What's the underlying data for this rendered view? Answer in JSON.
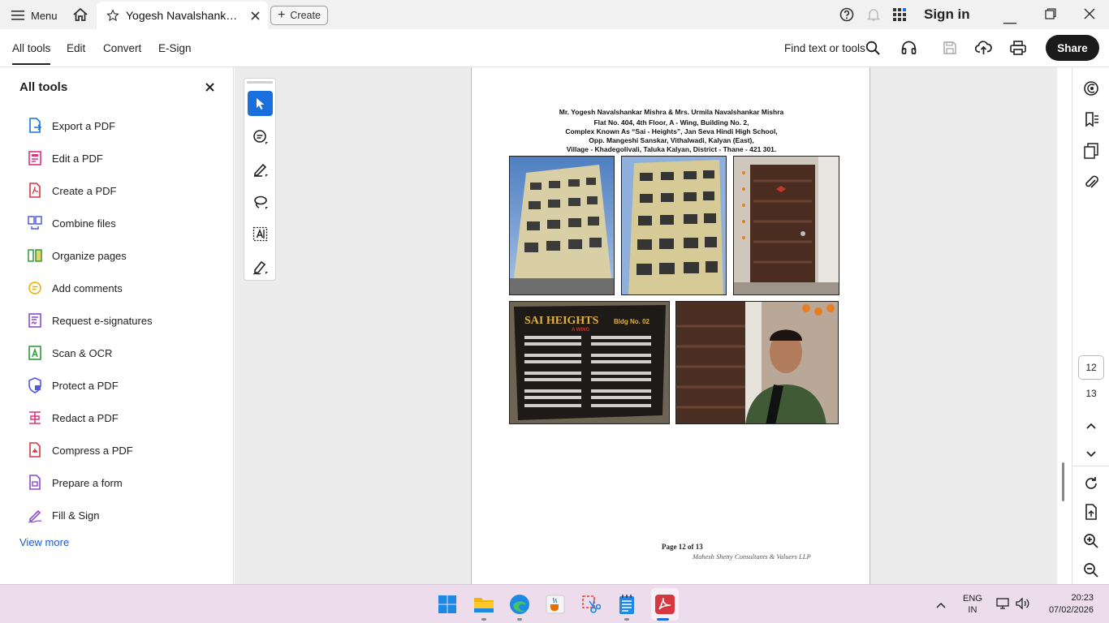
{
  "titlebar": {
    "menu_label": "Menu",
    "tab_title": "Yogesh Navalshankar M...",
    "create_label": "Create",
    "sign_in": "Sign in"
  },
  "menubar": {
    "tabs": [
      "All tools",
      "Edit",
      "Convert",
      "E-Sign"
    ],
    "find_text": "Find text or tools",
    "share_label": "Share"
  },
  "left_panel": {
    "title": "All tools",
    "tools": [
      {
        "label": "Export a PDF",
        "icon": "export-pdf-icon",
        "color": "#1473e6"
      },
      {
        "label": "Edit a PDF",
        "icon": "edit-pdf-icon",
        "color": "#e0317f"
      },
      {
        "label": "Create a PDF",
        "icon": "create-pdf-icon",
        "color": "#d7373f"
      },
      {
        "label": "Combine files",
        "icon": "combine-files-icon",
        "color": "#5258e4"
      },
      {
        "label": "Organize pages",
        "icon": "organize-pages-icon",
        "color": "#2d9d3a"
      },
      {
        "label": "Add comments",
        "icon": "add-comments-icon",
        "color": "#e8b100"
      },
      {
        "label": "Request e-signatures",
        "icon": "request-esign-icon",
        "color": "#8c4ad0"
      },
      {
        "label": "Scan & OCR",
        "icon": "scan-ocr-icon",
        "color": "#2d9d3a"
      },
      {
        "label": "Protect a PDF",
        "icon": "protect-pdf-icon",
        "color": "#5258e4"
      },
      {
        "label": "Redact a PDF",
        "icon": "redact-pdf-icon",
        "color": "#e0317f"
      },
      {
        "label": "Compress a PDF",
        "icon": "compress-pdf-icon",
        "color": "#d7373f"
      },
      {
        "label": "Prepare a form",
        "icon": "prepare-form-icon",
        "color": "#8c4ad0"
      },
      {
        "label": "Fill & Sign",
        "icon": "fill-sign-icon",
        "color": "#8c4ad0"
      }
    ],
    "view_more": "View more"
  },
  "document": {
    "address_lines": [
      "Mr. Yogesh Navalshankar Mishra & Mrs. Urmila Navalshankar Mishra",
      "Flat No. 404, 4th Floor, A - Wing, Building No. 2,",
      "Complex Known As “Sai - Heights”, Jan Seva Hindi High School,",
      "Opp. Mangeshi Sanskar, Vithalwadi, Kalyan (East),",
      "Village - Khadegolivali, Taluka Kalyan, District - Thane - 421 301."
    ],
    "board_title": "SAI HEIGHTS",
    "board_bldg": "Bldg No. 02",
    "board_wing": "A WING",
    "page_label": "Page 12 of 13",
    "signature": "Mahesh Shetty Consultants & Valuers LLP"
  },
  "right_rail": {
    "current_page": "12",
    "total_page": "13"
  },
  "taskbar": {
    "lang_line1": "ENG",
    "lang_line2": "IN",
    "time": "20:23",
    "date": "07/02/2026"
  },
  "colors": {
    "accent": "#1a6fdf",
    "taskbar_bg": "#ecdcec",
    "share_bg": "#1b1b1b"
  }
}
